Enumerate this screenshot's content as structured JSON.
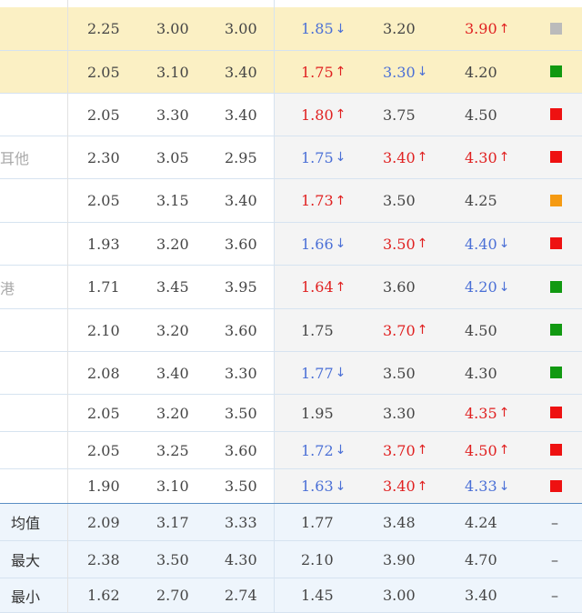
{
  "colors": {
    "up": "#e02020",
    "down": "#4a6fd6",
    "highlight": "#fbf0c4",
    "square_gray": "#bbbbbb",
    "square_green": "#119911",
    "square_red": "#ee1111",
    "square_orange": "#f59a12"
  },
  "rows": [
    {
      "name": "",
      "h": [
        "2.25",
        "3.00",
        "3.00"
      ],
      "c": [
        "1.85",
        "3.20",
        "3.90"
      ],
      "t": [
        "down",
        "plain",
        "up"
      ],
      "sq": "gray",
      "hl": true
    },
    {
      "name": "",
      "h": [
        "2.05",
        "3.10",
        "3.40"
      ],
      "c": [
        "1.75",
        "3.30",
        "4.20"
      ],
      "t": [
        "up",
        "down",
        "plain"
      ],
      "sq": "green",
      "hl": true
    },
    {
      "name": "",
      "h": [
        "2.05",
        "3.30",
        "3.40"
      ],
      "c": [
        "1.80",
        "3.75",
        "4.50"
      ],
      "t": [
        "up",
        "plain",
        "plain"
      ],
      "sq": "red",
      "hl": false
    },
    {
      "name": "耳他",
      "h": [
        "2.30",
        "3.05",
        "2.95"
      ],
      "c": [
        "1.75",
        "3.40",
        "4.30"
      ],
      "t": [
        "down",
        "up",
        "up"
      ],
      "sq": "red",
      "hl": false
    },
    {
      "name": "",
      "h": [
        "2.05",
        "3.15",
        "3.40"
      ],
      "c": [
        "1.73",
        "3.50",
        "4.25"
      ],
      "t": [
        "up",
        "plain",
        "plain"
      ],
      "sq": "orange",
      "hl": false
    },
    {
      "name": "",
      "h": [
        "1.93",
        "3.20",
        "3.60"
      ],
      "c": [
        "1.66",
        "3.50",
        "4.40"
      ],
      "t": [
        "down",
        "up",
        "down"
      ],
      "sq": "red",
      "hl": false
    },
    {
      "name": "港",
      "h": [
        "1.71",
        "3.45",
        "3.95"
      ],
      "c": [
        "1.64",
        "3.60",
        "4.20"
      ],
      "t": [
        "up",
        "plain",
        "down"
      ],
      "sq": "green",
      "hl": false
    },
    {
      "name": "",
      "h": [
        "2.10",
        "3.20",
        "3.60"
      ],
      "c": [
        "1.75",
        "3.70",
        "4.50"
      ],
      "t": [
        "plain",
        "up",
        "plain"
      ],
      "sq": "green",
      "hl": false
    },
    {
      "name": "",
      "h": [
        "2.08",
        "3.40",
        "3.30"
      ],
      "c": [
        "1.77",
        "3.50",
        "4.30"
      ],
      "t": [
        "down",
        "plain",
        "plain"
      ],
      "sq": "green",
      "hl": false
    },
    {
      "name": "",
      "h": [
        "2.05",
        "3.20",
        "3.50"
      ],
      "c": [
        "1.95",
        "3.30",
        "4.35"
      ],
      "t": [
        "plain",
        "plain",
        "up"
      ],
      "sq": "red",
      "hl": false
    },
    {
      "name": "",
      "h": [
        "2.05",
        "3.25",
        "3.60"
      ],
      "c": [
        "1.72",
        "3.70",
        "4.50"
      ],
      "t": [
        "down",
        "up",
        "up"
      ],
      "sq": "red",
      "hl": false
    },
    {
      "name": "",
      "h": [
        "1.90",
        "3.10",
        "3.50"
      ],
      "c": [
        "1.63",
        "3.40",
        "4.33"
      ],
      "t": [
        "down",
        "up",
        "down"
      ],
      "sq": "red",
      "hl": false
    }
  ],
  "summary": [
    {
      "name": "均值",
      "h": [
        "2.09",
        "3.17",
        "3.33"
      ],
      "c": [
        "1.77",
        "3.48",
        "4.24"
      ],
      "mark": "–"
    },
    {
      "name": "最大",
      "h": [
        "2.38",
        "3.50",
        "4.30"
      ],
      "c": [
        "2.10",
        "3.90",
        "4.70"
      ],
      "mark": "–"
    },
    {
      "name": "最小",
      "h": [
        "1.62",
        "2.70",
        "2.74"
      ],
      "c": [
        "1.45",
        "3.00",
        "3.40"
      ],
      "mark": "–"
    }
  ]
}
